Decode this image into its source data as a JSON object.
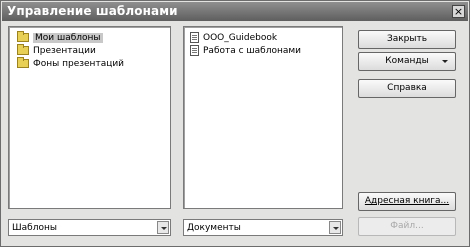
{
  "window": {
    "title": "Управление шаблонами",
    "close_symbol": "×"
  },
  "left_panel": {
    "items": [
      {
        "label": "Мои шаблоны",
        "icon": "folder-icon"
      },
      {
        "label": "Презентации",
        "icon": "folder-icon"
      },
      {
        "label": "Фоны презентаций",
        "icon": "folder-icon"
      }
    ]
  },
  "right_panel": {
    "items": [
      {
        "label": "OOO_Guidebook",
        "icon": "document-icon"
      },
      {
        "label": "Работа с шаблонами",
        "icon": "document-icon"
      }
    ]
  },
  "buttons": {
    "close": "Закрыть",
    "commands": "Команды",
    "help": "Справка",
    "address_book": "Адресная книга...",
    "file": "Файл..."
  },
  "combos": {
    "left_value": "Шаблоны",
    "right_value": "Документы"
  }
}
